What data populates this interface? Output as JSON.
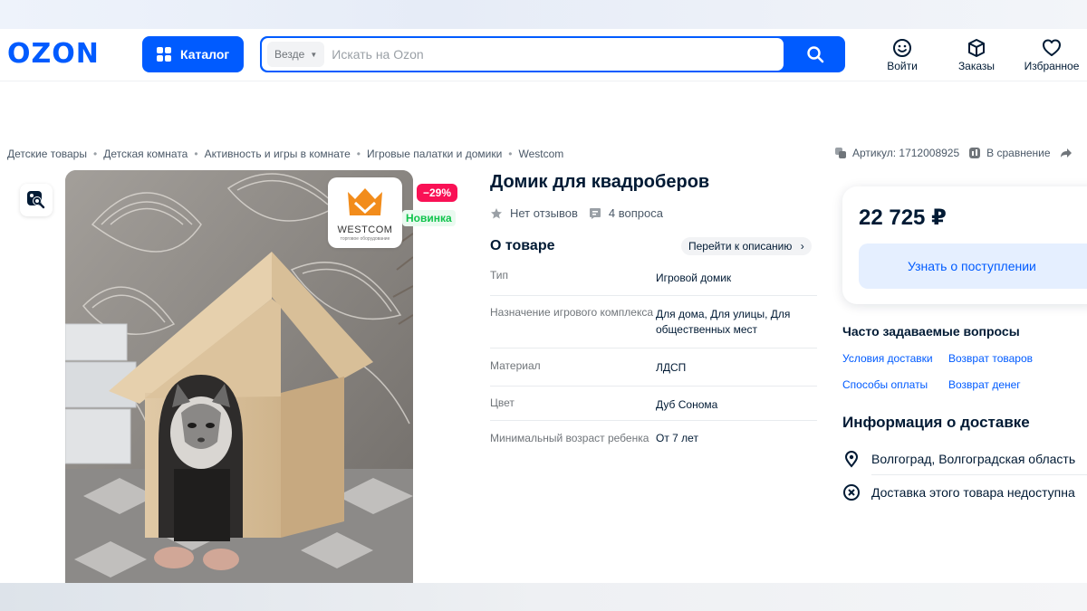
{
  "header": {
    "logo": "OZON",
    "catalog_label": "Каталог",
    "search": {
      "scope": "Везде",
      "placeholder": "Искать на Ozon"
    },
    "actions": {
      "login": "Войти",
      "orders": "Заказы",
      "favorites": "Избранное"
    }
  },
  "breadcrumbs": [
    "Детские товары",
    "Детская комната",
    "Активность и игры в комнате",
    "Игровые палатки и домики",
    "Westcom"
  ],
  "meta": {
    "article": "Артикул: 1712008925",
    "compare": "В сравнение"
  },
  "gallery": {
    "brand_badge": "WESTCOM",
    "brand_subtitle": "торговое оборудование",
    "discount_badge": "−29%",
    "new_badge": "Новинка"
  },
  "product": {
    "title": "Домик для квадроберов",
    "reviews": "Нет отзывов",
    "questions": "4 вопроса",
    "about_title": "О товаре",
    "goto_description": "Перейти к описанию",
    "specs": [
      {
        "key": "Тип",
        "value": "Игровой домик"
      },
      {
        "key": "Назначение игрового комплекса",
        "value": "Для дома, Для улицы, Для общественных мест"
      },
      {
        "key": "Материал",
        "value": "ЛДСП"
      },
      {
        "key": "Цвет",
        "value": "Дуб Сонома"
      },
      {
        "key": "Минимальный возраст ребенка",
        "value": "От 7 лет"
      }
    ]
  },
  "buy_box": {
    "price": "22 725 ₽",
    "notify_button": "Узнать о поступлении"
  },
  "faq": {
    "title": "Часто задаваемые вопросы",
    "links": [
      "Условия доставки",
      "Возврат товаров",
      "Способы оплаты",
      "Возврат денег"
    ]
  },
  "delivery": {
    "title": "Информация о доставке",
    "location": "Волгоград, Волгоградская область",
    "status": "Доставка этого товара недоступна"
  },
  "colors": {
    "brand_blue": "#005bff",
    "discount_red": "#f91155",
    "new_green": "#10c44c"
  }
}
